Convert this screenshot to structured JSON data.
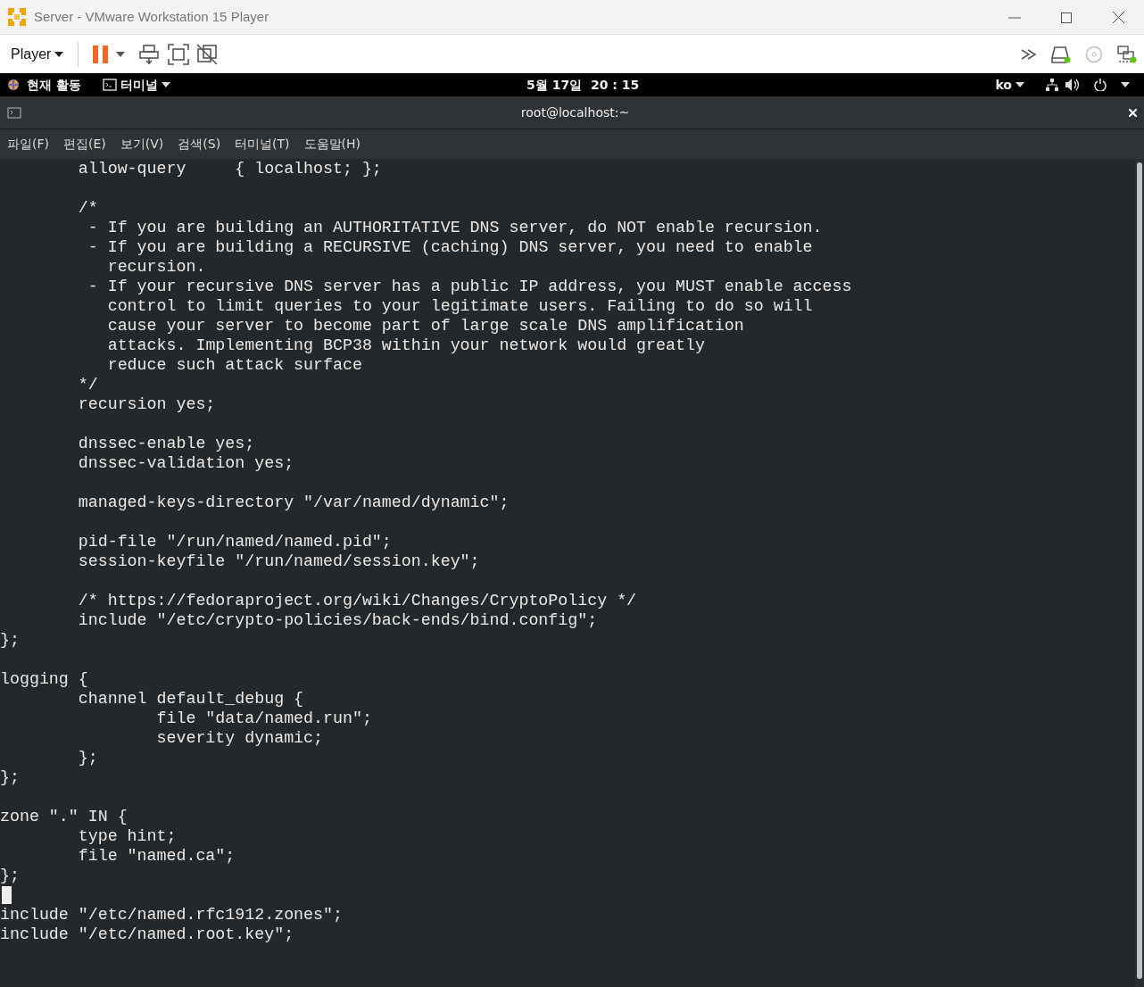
{
  "window": {
    "title": "Server - VMware Workstation 15 Player"
  },
  "toolbar": {
    "menu_label": "Player"
  },
  "top_bar": {
    "activities": "현재 활동",
    "app_menu": "터미널",
    "clock": "5월 17일  20 : 15",
    "input_method": "ko"
  },
  "terminal": {
    "title": "root@localhost:~",
    "menu": [
      "파일(F)",
      "편집(E)",
      "보기(V)",
      "검색(S)",
      "터미널(T)",
      "도움말(H)"
    ],
    "lines": [
      {
        "kind": "text",
        "text": "        allow-query     { localhost; };"
      },
      {
        "kind": "blank"
      },
      {
        "kind": "text",
        "text": "        /*"
      },
      {
        "kind": "text",
        "text": "         - If you are building an AUTHORITATIVE DNS server, do NOT enable recursion."
      },
      {
        "kind": "text",
        "text": "         - If you are building a RECURSIVE (caching) DNS server, you need to enable"
      },
      {
        "kind": "text",
        "text": "           recursion."
      },
      {
        "kind": "text",
        "text": "         - If your recursive DNS server has a public IP address, you MUST enable access"
      },
      {
        "kind": "text",
        "text": "           control to limit queries to your legitimate users. Failing to do so will"
      },
      {
        "kind": "text",
        "text": "           cause your server to become part of large scale DNS amplification"
      },
      {
        "kind": "text",
        "text": "           attacks. Implementing BCP38 within your network would greatly"
      },
      {
        "kind": "text",
        "text": "           reduce such attack surface"
      },
      {
        "kind": "text",
        "text": "        */"
      },
      {
        "kind": "text",
        "text": "        recursion yes;"
      },
      {
        "kind": "blank"
      },
      {
        "kind": "text",
        "text": "        dnssec-enable yes;"
      },
      {
        "kind": "text",
        "text": "        dnssec-validation yes;"
      },
      {
        "kind": "blank"
      },
      {
        "kind": "text",
        "text": "        managed-keys-directory \"/var/named/dynamic\";"
      },
      {
        "kind": "blank"
      },
      {
        "kind": "text",
        "text": "        pid-file \"/run/named/named.pid\";"
      },
      {
        "kind": "text",
        "text": "        session-keyfile \"/run/named/session.key\";"
      },
      {
        "kind": "blank"
      },
      {
        "kind": "text",
        "text": "        /* https://fedoraproject.org/wiki/Changes/CryptoPolicy */"
      },
      {
        "kind": "text",
        "text": "        include \"/etc/crypto-policies/back-ends/bind.config\";"
      },
      {
        "kind": "text",
        "text": "};"
      },
      {
        "kind": "blank"
      },
      {
        "kind": "text",
        "text": "logging {"
      },
      {
        "kind": "text",
        "text": "        channel default_debug {"
      },
      {
        "kind": "text",
        "text": "                file \"data/named.run\";"
      },
      {
        "kind": "text",
        "text": "                severity dynamic;"
      },
      {
        "kind": "text",
        "text": "        };"
      },
      {
        "kind": "text",
        "text": "};"
      },
      {
        "kind": "blank"
      },
      {
        "kind": "text",
        "text": "zone \".\" IN {"
      },
      {
        "kind": "text",
        "text": "        type hint;"
      },
      {
        "kind": "text",
        "text": "        file \"named.ca\";"
      },
      {
        "kind": "text",
        "text": "};"
      },
      {
        "kind": "cursor"
      },
      {
        "kind": "text",
        "text": "include \"/etc/named.rfc1912.zones\";"
      },
      {
        "kind": "text",
        "text": "include \"/etc/named.root.key\";"
      }
    ]
  }
}
